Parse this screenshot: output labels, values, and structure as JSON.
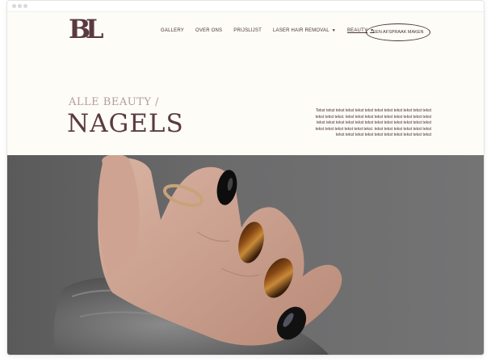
{
  "header": {
    "logo_text": "BL",
    "nav": [
      {
        "label": "GALLERY"
      },
      {
        "label": "OVER ONS"
      },
      {
        "label": "PRIJSLIJST"
      },
      {
        "label": "LASER HAIR REMOVAL",
        "dropdown": true
      },
      {
        "label": "BEAUTY",
        "dropdown": true,
        "active": true
      }
    ],
    "cta_label": "EEN AFSPRAAK MAKEN"
  },
  "intro": {
    "eyebrow": "ALLE BEAUTY /",
    "title": "NAGELS",
    "body": "Tekst tekst tekst tekst tekst tekst tekst tekst tekst tekst tekst tekst tekst tekst tekst. tekst tekst tekst tekst tekst tekst tekst tekst tekst tekst tekst tekst tekst tekst tekst tekst tekst tekst tekst tekst tekst tekst tekst tekst tekst tekst tekst. tekst tekst tekst tekst tekst tekst tekst tekst tekst tekst tekst tekst tekst tekst tekst tekst"
  },
  "hero": {
    "image": "hand-with-tortoiseshell-nails-photo"
  },
  "colors": {
    "brand": "#5a3a40",
    "accent": "#b59aa0",
    "background": "#fdfcf7"
  }
}
